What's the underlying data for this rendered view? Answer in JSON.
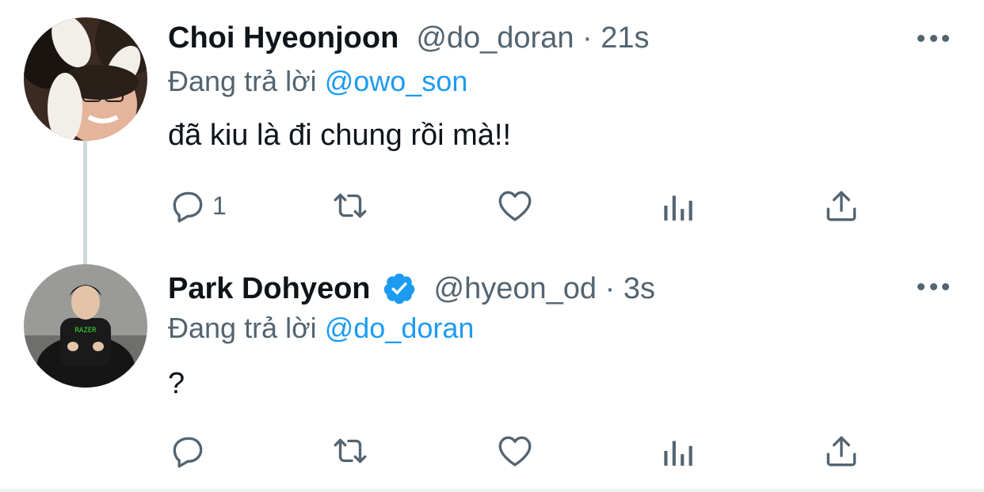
{
  "tweets": [
    {
      "name": "Choi Hyeonjoon",
      "handle_time": "@do_doran · 21s",
      "replying_prefix": "Đang trả lời",
      "replying_to": "@owo_son",
      "text": "đã kiu là đi chung rồi mà!!",
      "reply_count": "1",
      "verified": false
    },
    {
      "name": "Park Dohyeon",
      "handle_time": "@hyeon_od · 3s",
      "replying_prefix": "Đang trả lời",
      "replying_to": "@do_doran",
      "text": "?",
      "reply_count": "",
      "verified": true
    }
  ],
  "colors": {
    "accent": "#1d9bf0",
    "muted": "#536471",
    "text": "#0f1419"
  },
  "icons": [
    "reply-icon",
    "retweet-icon",
    "like-icon",
    "analytics-icon",
    "share-icon",
    "more-icon",
    "verified-icon"
  ]
}
